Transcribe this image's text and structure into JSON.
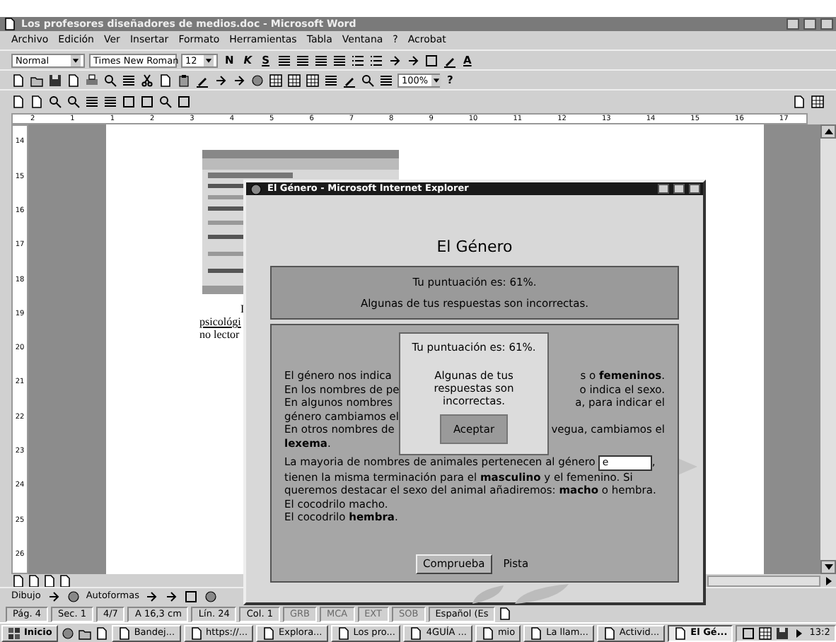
{
  "word": {
    "title": "Los profesores diseñadores de medios.doc - Microsoft Word",
    "menu": [
      "Archivo",
      "Edición",
      "Ver",
      "Insertar",
      "Formato",
      "Herramientas",
      "Tabla",
      "Ventana",
      "?",
      "Acrobat"
    ],
    "style_box": "Normal",
    "font_box": "Times New Roman",
    "size_box": "12",
    "format_buttons": [
      "N",
      "K",
      "S"
    ],
    "font_color_button": "A",
    "zoom_box": "100%",
    "help_button": "?",
    "hruler": [
      "2",
      "1",
      "1",
      "2",
      "3",
      "4",
      "5",
      "6",
      "7",
      "8",
      "9",
      "10",
      "11",
      "12",
      "13",
      "14",
      "15",
      "16",
      "17"
    ],
    "vruler": [
      "14",
      "15",
      "16",
      "17",
      "18",
      "19",
      "20",
      "21",
      "22",
      "23",
      "24",
      "25",
      "26"
    ],
    "document_lines": [
      "I",
      "psicológi",
      "no lector"
    ],
    "drawing_toolbar": [
      "Dibujo",
      "Autoformas"
    ],
    "status_bar": [
      {
        "text": "Pág. 4",
        "disabled": false
      },
      {
        "text": "Sec. 1",
        "disabled": false
      },
      {
        "text": "4/7",
        "disabled": false
      },
      {
        "text": "A 16,3 cm",
        "disabled": false
      },
      {
        "text": "Lín. 24",
        "disabled": false
      },
      {
        "text": "Col. 1",
        "disabled": false
      },
      {
        "text": "GRB",
        "disabled": true
      },
      {
        "text": "MCA",
        "disabled": true
      },
      {
        "text": "EXT",
        "disabled": true
      },
      {
        "text": "SOB",
        "disabled": true
      },
      {
        "text": "Español (Es",
        "disabled": false
      }
    ]
  },
  "ie": {
    "title": "El Género - Microsoft Internet Explorer",
    "heading": "El Género",
    "feedback": [
      "Tu puntuación es: 61%.",
      "Algunas de tus respuestas son incorrectas."
    ],
    "rows": [
      {
        "left": "El género nos indica",
        "right": "s o **femeninos**."
      },
      {
        "left": "En los nombres de pe",
        "right": "o indica el sexo."
      },
      {
        "left": "En algunos nombres",
        "right": "a, para indicar el"
      },
      {
        "left": "género cambiamos el"
      },
      {
        "left": "En otros nombres de",
        "right": "vegua, cambiamos el"
      },
      {
        "left": "**lexema**."
      }
    ],
    "gap_sentence": {
      "before": "La mayoria de nombres de animales pertenecen al género",
      "value": "e",
      "after": ","
    },
    "lines": [
      "tienen la misma terminación para el **masculino** y el femenino. Si",
      "queremos destacar el sexo del animal añadiremos: **macho** o hembra.",
      "El cocodrilo macho.",
      "El cocodrilo **hembra**."
    ],
    "check_button": "Comprueba",
    "hint_link": "Pista",
    "dialog": {
      "lines": [
        "Tu puntuación es: 61%.",
        "Algunas de tus respuestas son incorrectas."
      ],
      "button": "Aceptar"
    }
  },
  "taskbar": {
    "start": "Inicio",
    "tasks": [
      {
        "label": "Bandej...",
        "selected": false
      },
      {
        "label": "https://...",
        "selected": false
      },
      {
        "label": "Explora...",
        "selected": false
      },
      {
        "label": "Los pro...",
        "selected": false
      },
      {
        "label": "4GUÍA ...",
        "selected": false
      },
      {
        "label": "mio",
        "selected": false
      },
      {
        "label": "La llam...",
        "selected": false
      },
      {
        "label": "Activid...",
        "selected": false
      },
      {
        "label": "El Gé...",
        "selected": true
      }
    ],
    "clock": "13:2"
  }
}
